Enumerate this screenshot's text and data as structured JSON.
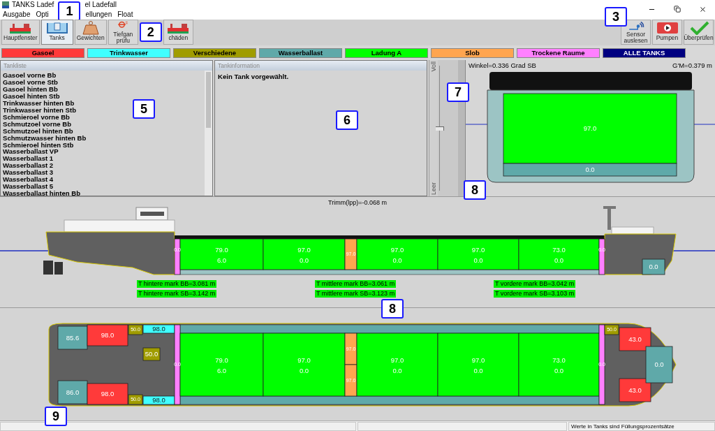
{
  "window": {
    "title_parts": [
      "TANKS  Ladef",
      "el Ladefall"
    ]
  },
  "menu": [
    "Ausgabe",
    "Opti",
    "ellungen",
    "Float"
  ],
  "toolbar_left": [
    {
      "kind": "ship",
      "lines": [
        "Hauptfenster"
      ],
      "selected": false
    },
    {
      "kind": "tanks",
      "lines": [
        "Tanks"
      ],
      "selected": true
    },
    {
      "kind": "weight",
      "lines": [
        "Gewichten"
      ],
      "selected": false
    },
    {
      "kind": "draft",
      "lines": [
        "Tiefgan",
        "prüfu"
      ],
      "selected": false
    },
    {
      "kind": "ship",
      "lines": [
        "chäden"
      ],
      "selected": false
    }
  ],
  "toolbar_right": [
    {
      "kind": "sensor",
      "lines": [
        "Sensor",
        "auslesen"
      ]
    },
    {
      "kind": "pump",
      "lines": [
        "Pumpen"
      ]
    },
    {
      "kind": "check",
      "lines": [
        "Überprüfen"
      ]
    }
  ],
  "legend": [
    {
      "kind": "gasoel",
      "label": "Gasoel",
      "color": "#ff3a3a"
    },
    {
      "kind": "trinkwasser",
      "label": "Trinkwasser",
      "color": "#40ffff"
    },
    {
      "kind": "verschiedene",
      "label": "Verschiedene",
      "color": "#a09c00"
    },
    {
      "kind": "wasserballast",
      "label": "Wasserballast",
      "color": "#5fa9a9"
    },
    {
      "kind": "ladung",
      "label": "Ladung A",
      "color": "#00ff00"
    },
    {
      "kind": "slob",
      "label": "Slob",
      "color": "#ffa54f"
    },
    {
      "kind": "trocken",
      "label": "Trockene Raume",
      "color": "#ff80ff"
    },
    {
      "kind": "alle",
      "label": "ALLE TANKS",
      "color": "#000080"
    }
  ],
  "tank_list": {
    "title": "Tankliste",
    "items": [
      "Gasoel vorne Bb",
      "Gasoel vorne Stb",
      "Gasoel hinten Bb",
      "Gasoel hinten Stb",
      "Trinkwasser hinten Bb",
      "Trinkwasser hinten Stb",
      "Schmieroel vorne Bb",
      "Schmutzoel vorne Bb",
      "Schmutzoel hinten Bb",
      "Schmutzwasser hinten Bb",
      "Schmieroel hinten Stb",
      "Wasserballast VP",
      "Wasserballast 1",
      "Wasserballast 2",
      "Wasserballast 3",
      "Wasserballast 4",
      "Wasserballast 5",
      "Wasserballast hinten Bb"
    ]
  },
  "tank_info": {
    "title": "Tankinformation",
    "text": "Kein Tank vorgewählt."
  },
  "fill_slider": {
    "top": "Voll",
    "bottom": "Leer",
    "level": 0.5
  },
  "cross_section": {
    "heel": "Winkel=0.336 Grad SB",
    "gm": "G'M=0.379 m",
    "tanks": [
      {
        "kind": "ladung",
        "values": [
          "97.0"
        ]
      },
      {
        "kind": "wasserballast",
        "values": [
          "0.0"
        ]
      }
    ]
  },
  "profile": {
    "trim": "Trimm(lpp)=-0.068 m",
    "tanks": [
      {
        "kind": "trocken",
        "values": [
          "0.0"
        ]
      },
      {
        "kind": "ladung",
        "values": [
          "79.0",
          "6.0"
        ]
      },
      {
        "kind": "ladung",
        "values": [
          "97.0",
          "0.0"
        ]
      },
      {
        "kind": "slob",
        "values": [
          "97.0"
        ]
      },
      {
        "kind": "ladung",
        "values": [
          "97.0",
          "0.0"
        ]
      },
      {
        "kind": "ladung",
        "values": [
          "97.0",
          "0.0"
        ]
      },
      {
        "kind": "ladung",
        "values": [
          "73.0",
          "0.0"
        ]
      },
      {
        "kind": "trocken",
        "values": [
          "0.0"
        ]
      },
      {
        "kind": "wasserballast",
        "values": [
          "0.0"
        ]
      }
    ],
    "marks": [
      "T hintere mark BB=3.081 m",
      "T hintere mark SB=3.142 m",
      "T mittlere mark BB=3.061 m",
      "T mittlere mark SB=3.123 m",
      "T vordere mark BB=3.042 m",
      "T vordere mark SB=3.103 m"
    ]
  },
  "plan": {
    "tanks": [
      {
        "kind": "wasserballast",
        "values": [
          "85.6"
        ]
      },
      {
        "kind": "gasoel",
        "values": [
          "98.0"
        ]
      },
      {
        "kind": "verschiedene",
        "values": [
          "50.0"
        ]
      },
      {
        "kind": "trinkwasser",
        "values": [
          "98.0"
        ]
      },
      {
        "kind": "verschiedene",
        "values": [
          "50.0"
        ]
      },
      {
        "kind": "wasserballast",
        "values": [
          "86.0"
        ]
      },
      {
        "kind": "gasoel",
        "values": [
          "98.0"
        ]
      },
      {
        "kind": "verschiedene",
        "values": [
          "50.0"
        ]
      },
      {
        "kind": "trinkwasser",
        "values": [
          "98.0"
        ]
      },
      {
        "kind": "trocken",
        "values": [
          "0.0"
        ]
      },
      {
        "kind": "ladung",
        "values": [
          "79.0",
          "6.0"
        ]
      },
      {
        "kind": "ladung",
        "values": [
          "97.0",
          "0.0"
        ]
      },
      {
        "kind": "slob",
        "values": [
          "97.0"
        ]
      },
      {
        "kind": "slob",
        "values": [
          "97.0"
        ]
      },
      {
        "kind": "ladung",
        "values": [
          "97.0",
          "0.0"
        ]
      },
      {
        "kind": "ladung",
        "values": [
          "97.0",
          "0.0"
        ]
      },
      {
        "kind": "ladung",
        "values": [
          "73.0",
          "0.0"
        ]
      },
      {
        "kind": "trocken",
        "values": [
          "0.0"
        ]
      },
      {
        "kind": "verschiedene",
        "values": [
          "50.0"
        ]
      },
      {
        "kind": "gasoel",
        "values": [
          "43.0"
        ]
      },
      {
        "kind": "gasoel",
        "values": [
          "43.0"
        ]
      },
      {
        "kind": "wasserballast",
        "values": [
          "0.0"
        ]
      }
    ]
  },
  "status_bar": {
    "message": "Werte in Tanks sind Füllungsprozentsätze"
  },
  "callouts": [
    "1",
    "2",
    "3",
    "5",
    "6",
    "7",
    "8",
    "8",
    "9"
  ]
}
